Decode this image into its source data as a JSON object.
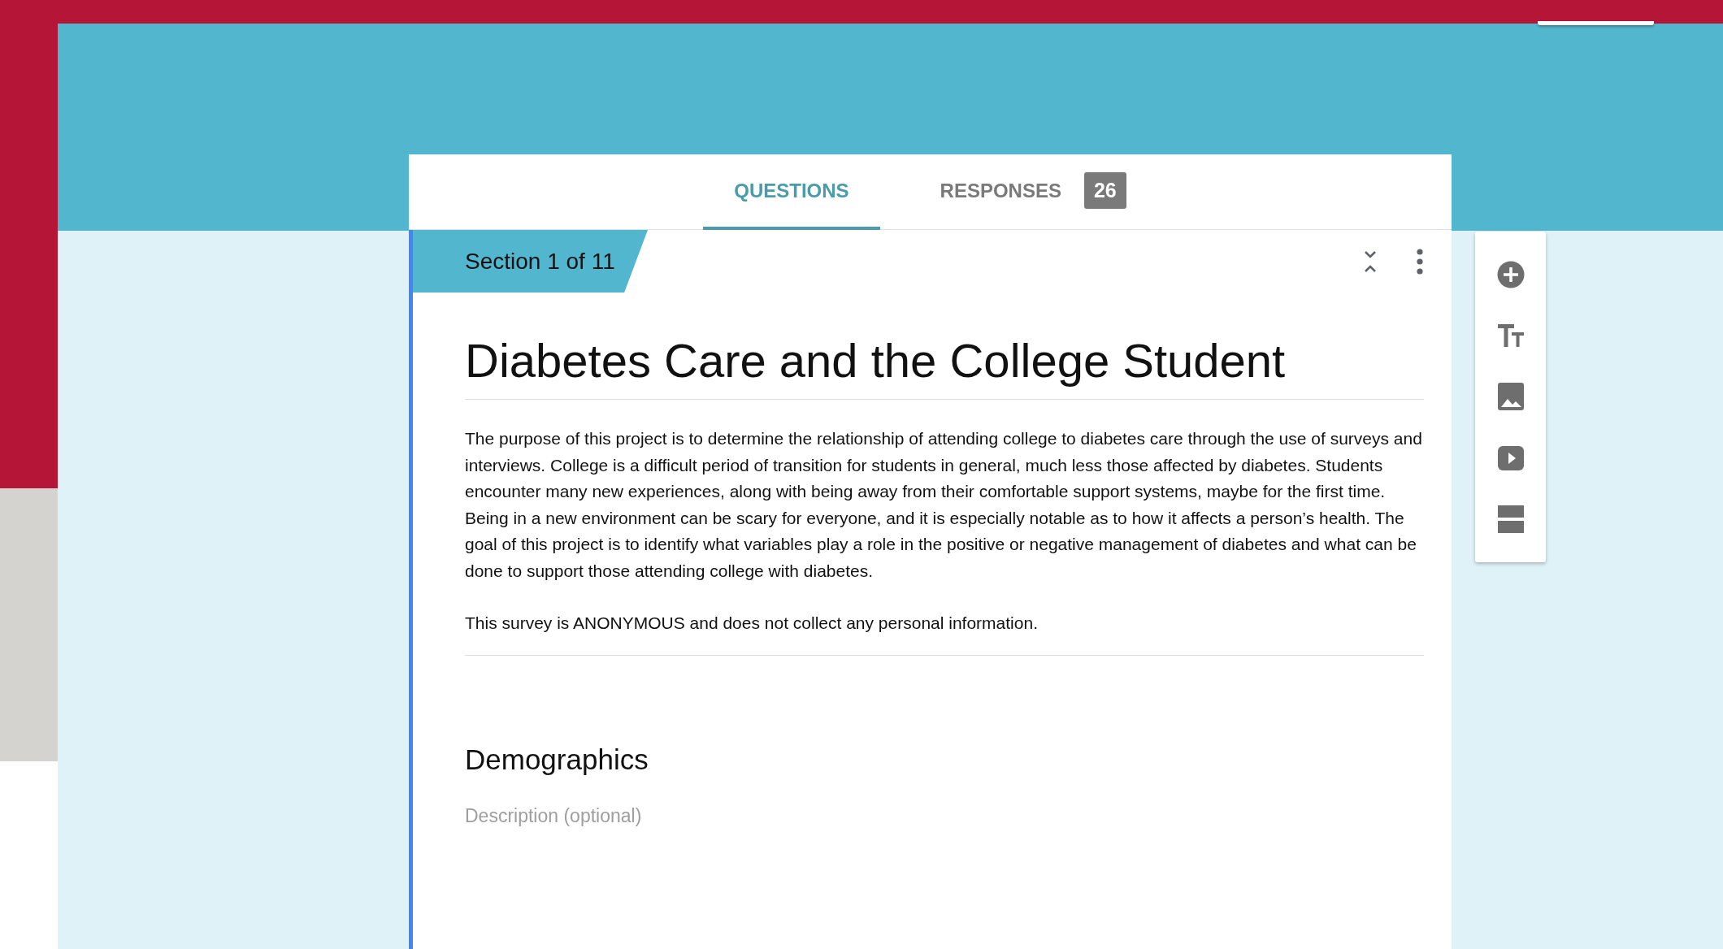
{
  "tabs": [
    {
      "label": "QUESTIONS",
      "selected": true
    },
    {
      "label": "RESPONSES",
      "selected": false,
      "badge": "26"
    }
  ],
  "section": {
    "label": "Section 1 of 11"
  },
  "form": {
    "title": "Diabetes Care and the College Student",
    "description": [
      "The purpose of this project is to determine the relationship of attending college to diabetes care through the use of surveys and interviews. College is a difficult period of transition for students in general, much less those affected by diabetes. Students encounter many new experiences, along with being away from their comfortable support systems, maybe for the first time. Being in a new environment can be scary for everyone, and it is especially notable as to how it affects a person’s health. The goal of this project is to identify what variables play a role in the positive or negative management of diabetes and what can be done to support those attending college with diabetes.",
      "This survey is ANONYMOUS and does not collect any personal information."
    ]
  },
  "next_section": {
    "title": "Demographics",
    "placeholder": "Description (optional)"
  }
}
